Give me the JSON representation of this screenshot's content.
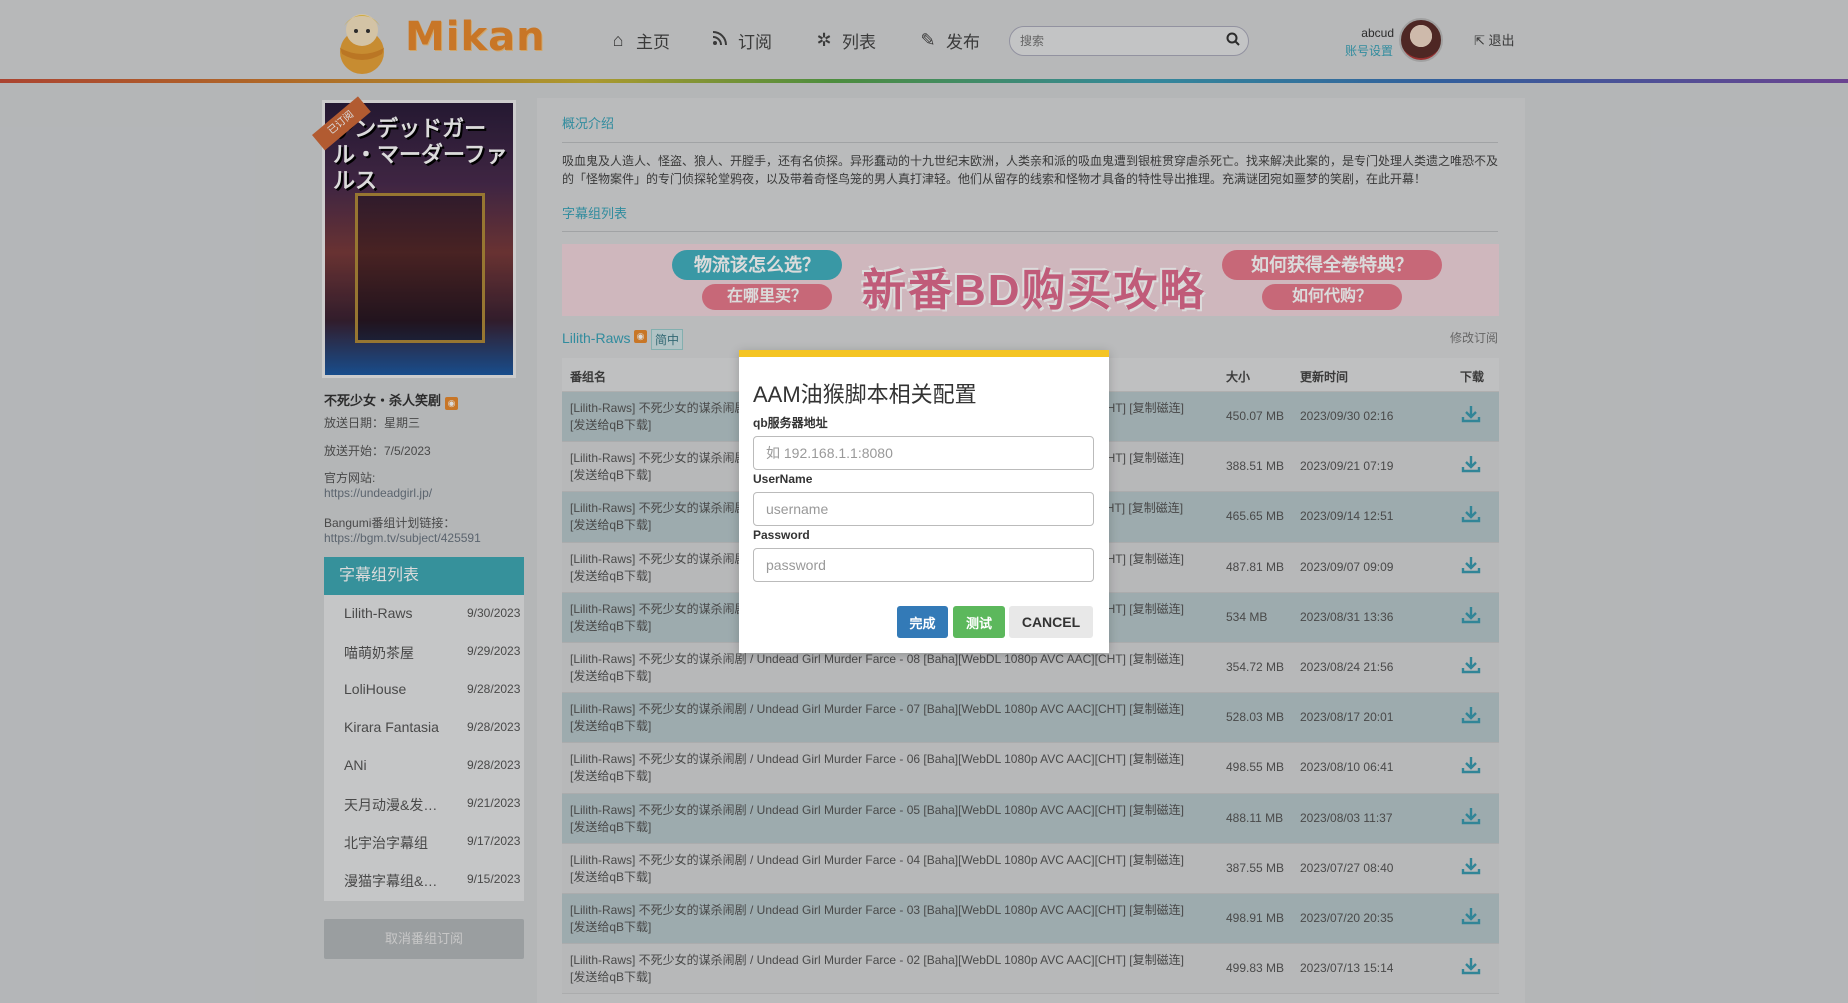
{
  "header": {
    "logo_text": "Mikan",
    "nav": [
      {
        "label": "主页",
        "icon": "home-icon"
      },
      {
        "label": "订阅",
        "icon": "rss-icon"
      },
      {
        "label": "列表",
        "icon": "gear-icon"
      },
      {
        "label": "发布",
        "icon": "edit-icon"
      }
    ],
    "search_placeholder": "搜索",
    "user": "abcud",
    "account_settings": "账号设置",
    "logout": "退出"
  },
  "sidebar": {
    "ribbon": "已订阅",
    "poster_title": "アンデッドガール・マーダーファルス",
    "anime_title": "不死少女・杀人笑剧",
    "air_day": "放送日期：星期三",
    "air_start": "放送开始：7/5/2023",
    "official_site_label": "官方网站:",
    "official_site": "https://undeadgirl.jp/",
    "bangumi_label": "Bangumi番组计划链接：",
    "bangumi_url": "https://bgm.tv/subject/425591",
    "sub_list_title": "字幕组列表",
    "sub_groups": [
      {
        "name": "Lilith-Raws",
        "date": "9/30/2023"
      },
      {
        "name": "喵萌奶茶屋",
        "date": "9/29/2023"
      },
      {
        "name": "LoliHouse",
        "date": "9/28/2023"
      },
      {
        "name": "Kirara Fantasia",
        "date": "9/28/2023"
      },
      {
        "name": "ANi",
        "date": "9/28/2023"
      },
      {
        "name": "天月动漫&发布组",
        "date": "9/21/2023"
      },
      {
        "name": "北宇治字幕组",
        "date": "9/17/2023"
      },
      {
        "name": "漫猫字幕组&爱恋字幕社",
        "date": "9/15/2023"
      }
    ],
    "unsubscribe": "取消番组订阅"
  },
  "main": {
    "overview_title": "概况介绍",
    "description": "吸血鬼及人造人、怪盗、狼人、开膛手，还有名侦探。异形蠢动的十九世纪末欧洲，人类亲和派的吸血鬼遭到银桩贯穿虐杀死亡。找来解决此案的，是专门处理人类遗之唯恐不及的「怪物案件」的专门侦探轮堂鸦夜，以及带着奇怪鸟笼的男人真打津轻。他们从留存的线索和怪物才具备的特性导出推理。充满谜团宛如噩梦的笑剧，在此开幕！",
    "sub_list_title": "字幕组列表",
    "banner": {
      "q1": "物流该怎么选？",
      "q2": "在哪里买？",
      "big": "新番BD购买攻略",
      "q3": "如何获得全卷特典？",
      "q4": "如何代购？"
    },
    "group_name": "Lilith-Raws",
    "group_tag": "简中",
    "modify_sub": "修改订阅",
    "table": {
      "headers": {
        "name": "番组名",
        "size": "大小",
        "time": "更新时间",
        "download": "下载"
      },
      "rows": [
        {
          "name": "[Lilith-Raws] 不死少女的谋杀闹剧 / Undead Girl Murder Farce - 13 [Baha][WebDL 1080p AVC AAC][CHT] [复制磁连] [发送给qB下载]",
          "size": "450.07 MB",
          "time": "2023/09/30 02:16"
        },
        {
          "name": "[Lilith-Raws] 不死少女的谋杀闹剧 / Undead Girl Murder Farce - 12 [Baha][WebDL 1080p AVC AAC][CHT] [复制磁连] [发送给qB下载]",
          "size": "388.51 MB",
          "time": "2023/09/21 07:19"
        },
        {
          "name": "[Lilith-Raws] 不死少女的谋杀闹剧 / Undead Girl Murder Farce - 11 [Baha][WebDL 1080p AVC AAC][CHT] [复制磁连] [发送给qB下载]",
          "size": "465.65 MB",
          "time": "2023/09/14 12:51"
        },
        {
          "name": "[Lilith-Raws] 不死少女的谋杀闹剧 / Undead Girl Murder Farce - 10 [Baha][WebDL 1080p AVC AAC][CHT] [复制磁连] [发送给qB下载]",
          "size": "487.81 MB",
          "time": "2023/09/07 09:09"
        },
        {
          "name": "[Lilith-Raws] 不死少女的谋杀闹剧 / Undead Girl Murder Farce - 09 [Baha][WebDL 1080p AVC AAC][CHT] [复制磁连] [发送给qB下载]",
          "size": "534 MB",
          "time": "2023/08/31 13:36"
        },
        {
          "name": "[Lilith-Raws] 不死少女的谋杀闹剧 / Undead Girl Murder Farce - 08 [Baha][WebDL 1080p AVC AAC][CHT] [复制磁连] [发送给qB下载]",
          "size": "354.72 MB",
          "time": "2023/08/24 21:56"
        },
        {
          "name": "[Lilith-Raws] 不死少女的谋杀闹剧 / Undead Girl Murder Farce - 07 [Baha][WebDL 1080p AVC AAC][CHT] [复制磁连] [发送给qB下载]",
          "size": "528.03 MB",
          "time": "2023/08/17 20:01"
        },
        {
          "name": "[Lilith-Raws] 不死少女的谋杀闹剧 / Undead Girl Murder Farce - 06 [Baha][WebDL 1080p AVC AAC][CHT] [复制磁连] [发送给qB下载]",
          "size": "498.55 MB",
          "time": "2023/08/10 06:41"
        },
        {
          "name": "[Lilith-Raws] 不死少女的谋杀闹剧 / Undead Girl Murder Farce - 05 [Baha][WebDL 1080p AVC AAC][CHT] [复制磁连] [发送给qB下载]",
          "size": "488.11 MB",
          "time": "2023/08/03 11:37"
        },
        {
          "name": "[Lilith-Raws] 不死少女的谋杀闹剧 / Undead Girl Murder Farce - 04 [Baha][WebDL 1080p AVC AAC][CHT] [复制磁连] [发送给qB下载]",
          "size": "387.55 MB",
          "time": "2023/07/27 08:40"
        },
        {
          "name": "[Lilith-Raws] 不死少女的谋杀闹剧 / Undead Girl Murder Farce - 03 [Baha][WebDL 1080p AVC AAC][CHT] [复制磁连] [发送给qB下载]",
          "size": "498.91 MB",
          "time": "2023/07/20 20:35"
        },
        {
          "name": "[Lilith-Raws] 不死少女的谋杀闹剧 / Undead Girl Murder Farce - 02 [Baha][WebDL 1080p AVC AAC][CHT] [复制磁连] [发送给qB下载]",
          "size": "499.83 MB",
          "time": "2023/07/13 15:14"
        }
      ]
    }
  },
  "modal": {
    "title": "AAM油猴脚本相关配置",
    "server_label": "qb服务器地址",
    "server_placeholder": "如 192.168.1.1:8080",
    "username_label": "UserName",
    "username_placeholder": "username",
    "password_label": "Password",
    "password_placeholder": "password",
    "done": "完成",
    "test": "测试",
    "cancel": "CANCEL"
  },
  "colors": {
    "accent": "#3aa3b8",
    "modal_top": "#f4c423",
    "done_btn": "#337ab7",
    "test_btn": "#5cb85c"
  }
}
